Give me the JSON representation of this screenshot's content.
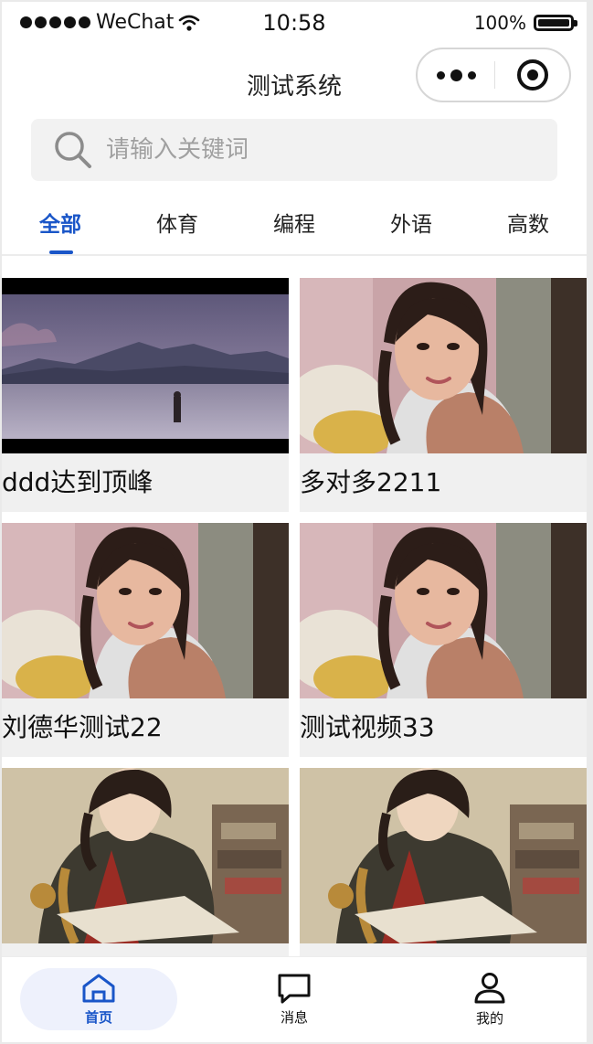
{
  "status_bar": {
    "carrier": "WeChat",
    "time": "10:58",
    "battery": "100%"
  },
  "nav": {
    "title": "测试系统"
  },
  "search": {
    "placeholder": "请输入关键词",
    "value": ""
  },
  "tabs": [
    {
      "label": "全部",
      "active": true
    },
    {
      "label": "体育",
      "active": false
    },
    {
      "label": "编程",
      "active": false
    },
    {
      "label": "外语",
      "active": false
    },
    {
      "label": "高数",
      "active": false
    }
  ],
  "videos": [
    {
      "title": "ddd达到顶峰",
      "thumb": "landscape"
    },
    {
      "title": "多对多2211",
      "thumb": "portrait"
    },
    {
      "title": "刘德华测试22",
      "thumb": "portrait"
    },
    {
      "title": "测试视频33",
      "thumb": "portrait"
    },
    {
      "title": "",
      "thumb": "anime"
    },
    {
      "title": "",
      "thumb": "anime"
    }
  ],
  "tab_bar": [
    {
      "label": "首页",
      "icon": "home-icon",
      "active": true
    },
    {
      "label": "消息",
      "icon": "message-icon",
      "active": false
    },
    {
      "label": "我的",
      "icon": "user-icon",
      "active": false
    }
  ],
  "colors": {
    "accent": "#1a56c8",
    "search_bg": "#f2f2f2",
    "active_tab_bg": "#eef1fc"
  }
}
